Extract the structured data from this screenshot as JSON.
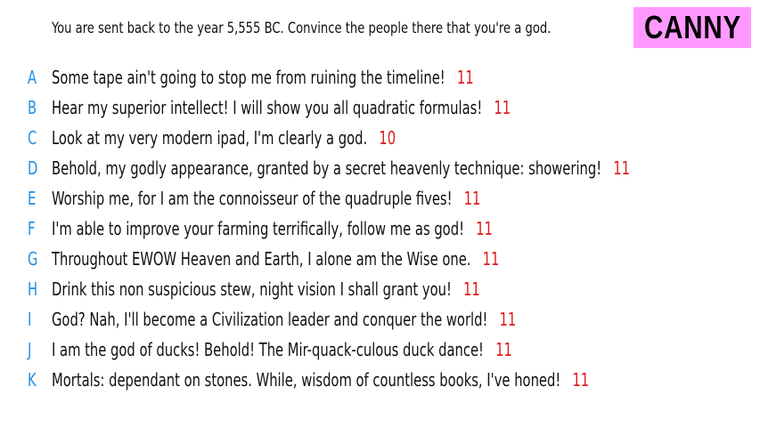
{
  "prompt": "You are sent back to the year 5,555 BC. Convince the people there that you're a god.",
  "badge": {
    "label": "CANNY",
    "color": "#ff99ff"
  },
  "colors": {
    "letter": "#1f8fe5",
    "score": "#e01b1b",
    "text": "#111111"
  },
  "entries": [
    {
      "letter": "A",
      "text": "Some tape ain't going to stop me from ruining the timeline!",
      "score": "11"
    },
    {
      "letter": "B",
      "text": "Hear my superior intellect! I will show you all quadratic formulas!",
      "score": "11"
    },
    {
      "letter": "C",
      "text": "Look at my very modern ipad, I'm clearly a god.",
      "score": "10"
    },
    {
      "letter": "D",
      "text": "Behold, my godly appearance, granted by a secret heavenly technique: showering!",
      "score": "11"
    },
    {
      "letter": "E",
      "text": "Worship me, for I am the connoisseur of the quadruple fives!",
      "score": "11"
    },
    {
      "letter": "F",
      "text": "I'm able to improve your farming terrifically, follow me as god!",
      "score": "11"
    },
    {
      "letter": "G",
      "text": "Throughout EWOW Heaven and Earth, I alone am the Wise one.",
      "score": "11"
    },
    {
      "letter": "H",
      "text": "Drink this non suspicious stew, night vision I shall grant you!",
      "score": "11"
    },
    {
      "letter": "I",
      "text": "God? Nah, I'll become a Civilization leader and conquer the world!",
      "score": "11"
    },
    {
      "letter": "J",
      "text": "I am the god of ducks! Behold! The Mir-quack-culous duck dance!",
      "score": "11"
    },
    {
      "letter": "K",
      "text": "Mortals: dependant on stones. While, wisdom of countless books, I've honed!",
      "score": "11"
    }
  ]
}
